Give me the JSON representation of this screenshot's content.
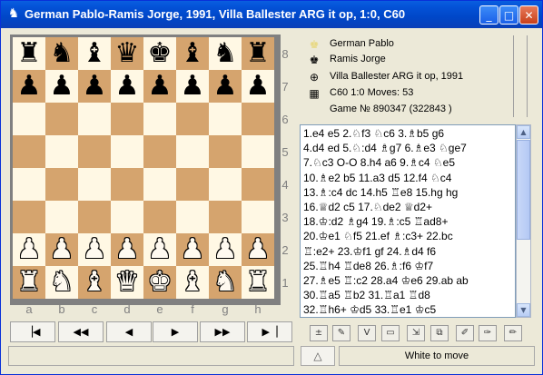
{
  "window": {
    "title": "German Pablo-Ramis Jorge, 1991, Villa Ballester ARG it op, 1:0, C60",
    "app_icon": "chess-knight-icon",
    "buttons": {
      "minimize": "_",
      "maximize": "□",
      "close": "✕"
    }
  },
  "board": {
    "ranks": [
      "8",
      "7",
      "6",
      "5",
      "4",
      "3",
      "2",
      "1"
    ],
    "files": [
      "a",
      "b",
      "c",
      "d",
      "e",
      "f",
      "g",
      "h"
    ],
    "position": [
      [
        "r",
        "n",
        "b",
        "q",
        "k",
        "b",
        "n",
        "r"
      ],
      [
        "p",
        "p",
        "p",
        "p",
        "p",
        "p",
        "p",
        "p"
      ],
      [
        "",
        "",
        "",
        "",
        "",
        "",
        "",
        ""
      ],
      [
        "",
        "",
        "",
        "",
        "",
        "",
        "",
        ""
      ],
      [
        "",
        "",
        "",
        "",
        "",
        "",
        "",
        ""
      ],
      [
        "",
        "",
        "",
        "",
        "",
        "",
        "",
        ""
      ],
      [
        "P",
        "P",
        "P",
        "P",
        "P",
        "P",
        "P",
        "P"
      ],
      [
        "R",
        "N",
        "B",
        "Q",
        "K",
        "B",
        "N",
        "R"
      ]
    ],
    "light_color": "#fff8e4",
    "dark_color": "#d5a46e"
  },
  "navigation": {
    "first": "▕◀",
    "back5": "◀◀",
    "back": "◀",
    "forward": "▶",
    "forward5": "▶▶",
    "last": "▶▕"
  },
  "game_info": {
    "white": "German Pablo",
    "black": "Ramis Jorge",
    "event": "Villa Ballester ARG it op, 1991",
    "details": "C60   1:0   Moves: 53",
    "game_no": "Game № 890347 (322843 )"
  },
  "moves": [
    "1.e4 e5 2.♘f3 ♘c6 3.♗b5 g6",
    "4.d4 ed 5.♘:d4 ♗g7 6.♗e3 ♘ge7",
    "7.♘c3 O-O 8.h4 a6 9.♗c4 ♘e5",
    "10.♗e2 b5 11.a3 d5 12.f4 ♘c4",
    "13.♗:c4 dc 14.h5 ♖e8 15.hg hg",
    "16.♕d2 c5 17.♘de2 ♕d2+",
    "18.♔:d2 ♗g4 19.♗:c5 ♖ad8+",
    "20.♔e1 ♘f5 21.ef ♗:c3+ 22.bc",
    "♖:e2+ 23.♔f1 gf 24.♗d4 f6",
    "25.♖h4 ♖de8 26.♗:f6 ♔f7",
    "27.♗e5 ♖:c2 28.a4 ♔e6 29.ab ab",
    "30.♖a5 ♖b2 31.♖a1 ♖d8",
    "32.♖h6+ ♔d5 33.♖e1 ♔c5"
  ],
  "status": {
    "turn": "White to move",
    "flip": "△"
  }
}
